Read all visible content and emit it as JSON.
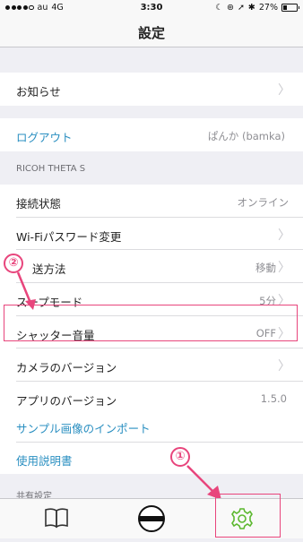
{
  "status_bar": {
    "carrier": "au",
    "network": "4G",
    "time": "3:30",
    "battery_percent": "27%",
    "battery_level": 0.27
  },
  "nav": {
    "title": "設定"
  },
  "rows": {
    "news": {
      "label": "お知らせ"
    },
    "logout": {
      "label": "ログアウト",
      "value": "ぱんか (bamka)"
    },
    "device_section": "RICOH THETA S",
    "connection": {
      "label": "接続状態",
      "value": "オンライン"
    },
    "wifi_password": {
      "label": "Wi-Fiパスワード変更"
    },
    "transfer": {
      "label": "送方法",
      "value": "移動"
    },
    "sleep": {
      "label": "スープモード",
      "value": "5分"
    },
    "shutter": {
      "label": "シャッター音量",
      "value": "OFF"
    },
    "camera_version": {
      "label": "カメラのバージョン"
    },
    "app_version": {
      "label": "アプリのバージョン",
      "value": "1.5.0"
    },
    "import_samples": {
      "label": "サンプル画像のインポート"
    },
    "manual": {
      "label": "使用説明書"
    },
    "share_section": "共有設定"
  },
  "annotations": {
    "one": "①",
    "two": "②"
  },
  "colors": {
    "link": "#2a8fc1",
    "annotation": "#e8457c",
    "gear_active": "#5cb82f"
  },
  "tabbar": {
    "items": [
      "book-icon",
      "theta-capture-icon",
      "gear-icon"
    ]
  }
}
